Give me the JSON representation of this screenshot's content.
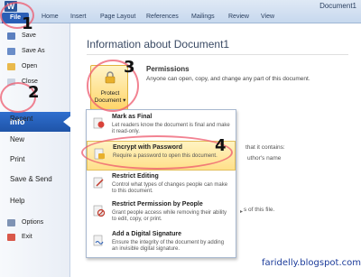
{
  "window": {
    "app_icon": "word-icon",
    "title": "Document1"
  },
  "ribbon": {
    "file": "File",
    "tabs": [
      "Home",
      "Insert",
      "Page Layout",
      "References",
      "Mailings",
      "Review",
      "View"
    ]
  },
  "sidebar": {
    "save": "Save",
    "save_as": "Save As",
    "open": "Open",
    "close": "Close",
    "info": "Info",
    "recent": "Recent",
    "new": "New",
    "print": "Print",
    "save_send": "Save & Send",
    "help": "Help",
    "options": "Options",
    "exit": "Exit"
  },
  "main": {
    "title": "Information about Document1",
    "protect_label_1": "Protect",
    "protect_label_2": "Document",
    "permissions_title": "Permissions",
    "permissions_desc": "Anyone can open, copy, and change any part of this document.",
    "side_that_contains": "that it contains:",
    "side_authors_name": "uthor's name",
    "side_of_this_file": "s of this file."
  },
  "protect_menu": [
    {
      "title": "Mark as Final",
      "desc": "Let readers know the document is final and make it read-only."
    },
    {
      "title": "Encrypt with Password",
      "desc": "Require a password to open this document."
    },
    {
      "title": "Restrict Editing",
      "desc": "Control what types of changes people can make to this document."
    },
    {
      "title": "Restrict Permission by People",
      "desc": "Grant people access while removing their ability to edit, copy, or print."
    },
    {
      "title": "Add a Digital Signature",
      "desc": "Ensure the integrity of the document by adding an invisible digital signature."
    }
  ],
  "annotations": [
    "1",
    "2",
    "3",
    "4"
  ],
  "watermark": "faridelly.blogspot.com",
  "colors": {
    "accent": "#2b5fb6",
    "highlight": "#ffe08a",
    "annotation": "#ed5a6e"
  }
}
